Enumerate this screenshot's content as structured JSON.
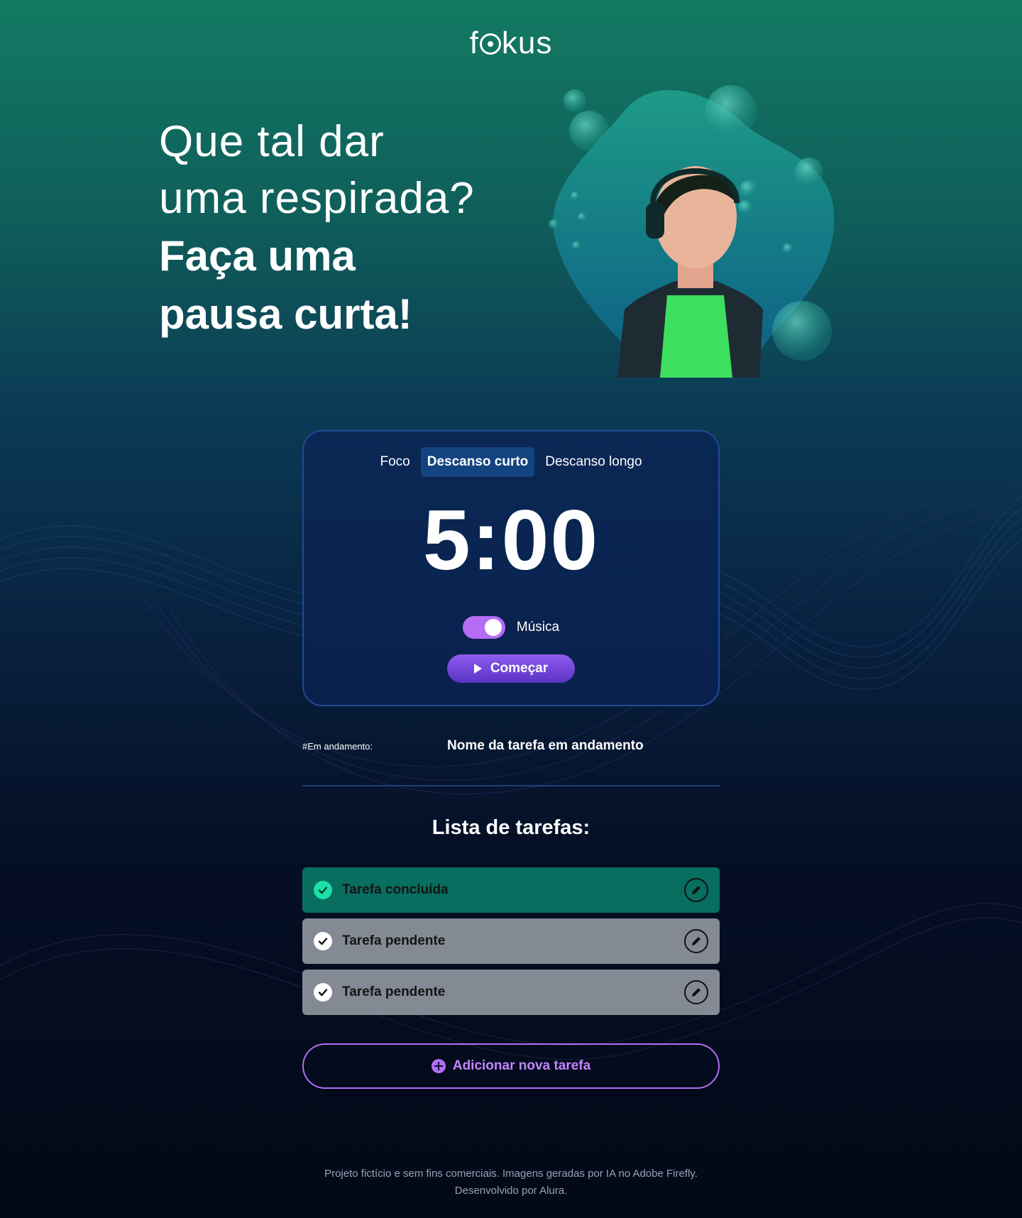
{
  "brand": {
    "logo_text_pre": "f",
    "logo_text_post": "kus"
  },
  "hero": {
    "line1": "Que tal dar",
    "line2": "uma respirada?",
    "line3": "Faça uma",
    "line4": "pausa curta!"
  },
  "timer": {
    "tabs": [
      {
        "label": "Foco",
        "active": false
      },
      {
        "label": "Descanso curto",
        "active": true
      },
      {
        "label": "Descanso longo",
        "active": false
      }
    ],
    "time": "5:00",
    "music_label": "Música",
    "music_on": true,
    "start_label": "Começar"
  },
  "current_task": {
    "label": "#Em andamento:",
    "name": "Nome da tarefa em andamento"
  },
  "task_list": {
    "title": "Lista de tarefas:",
    "items": [
      {
        "name": "Tarefa concluída",
        "status": "done"
      },
      {
        "name": "Tarefa pendente",
        "status": "pending"
      },
      {
        "name": "Tarefa pendente",
        "status": "pending"
      }
    ],
    "add_label": "Adicionar nova tarefa"
  },
  "footer": {
    "line1": "Projeto fictício e sem fins comerciais. Imagens geradas por IA no Adobe Firefly.",
    "line2": "Desenvolvido por Alura."
  },
  "colors": {
    "accent_purple": "#b46cf5",
    "done_green": "#076e60",
    "check_green": "#1bdfa6",
    "pending_gray": "#848a94",
    "active_tab": "#144480"
  },
  "icons": {
    "start": "play-icon",
    "check": "check-icon",
    "edit": "pencil-icon",
    "add": "plus-circle-icon"
  }
}
